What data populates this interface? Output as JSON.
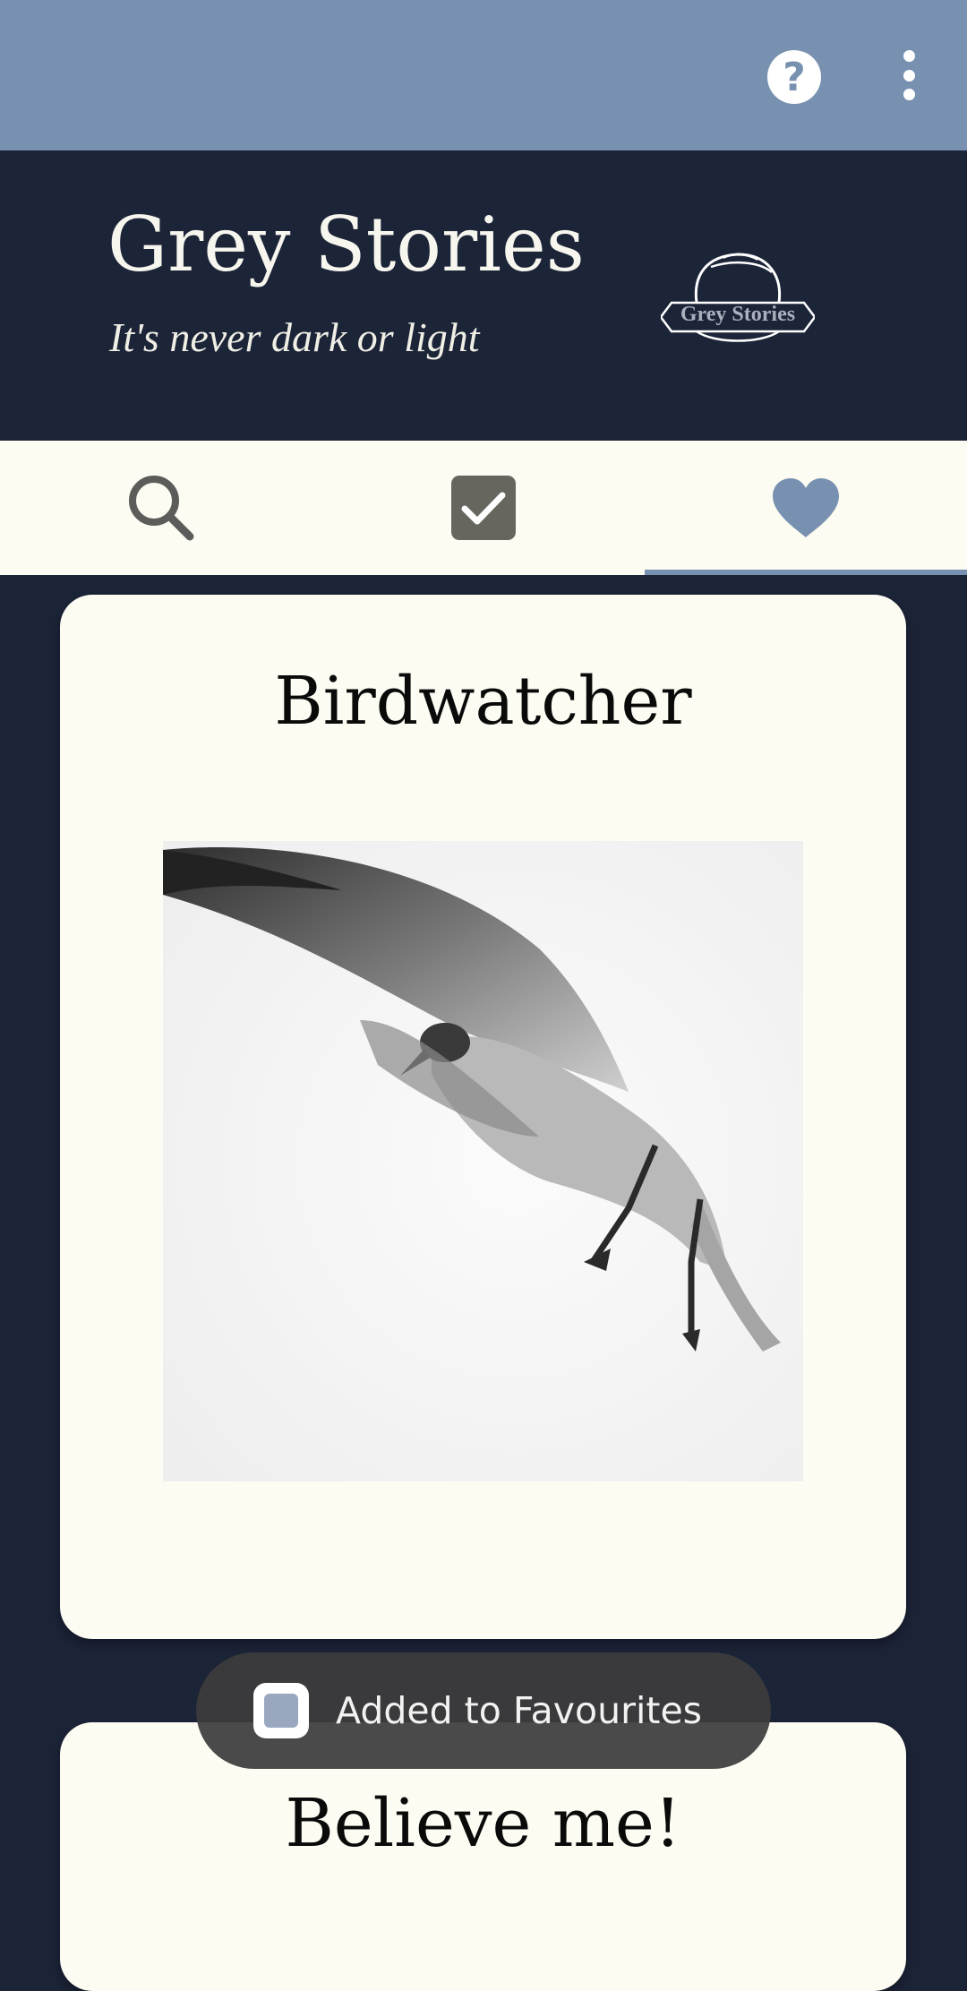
{
  "app": {
    "title": "Grey Stories",
    "tagline": "It's never dark or light",
    "logo_text": "Grey Stories",
    "colors": {
      "appbar": "#7891b0",
      "header": "#1c2438",
      "card": "#fdfcf3",
      "accent": "#7891b0"
    }
  },
  "appbar": {
    "actions": [
      {
        "name": "help",
        "icon": "help-circle-icon"
      },
      {
        "name": "more",
        "icon": "more-vert-icon"
      }
    ]
  },
  "tabs": [
    {
      "name": "search",
      "icon": "search-icon",
      "selected": false
    },
    {
      "name": "read",
      "icon": "checkbox-icon",
      "selected": false
    },
    {
      "name": "favourites",
      "icon": "heart-icon",
      "selected": true
    }
  ],
  "stories": [
    {
      "title": "Birdwatcher",
      "image": "seagull-photo"
    },
    {
      "title": "Believe me!"
    }
  ],
  "toast": {
    "message": "Added to Favourites"
  }
}
